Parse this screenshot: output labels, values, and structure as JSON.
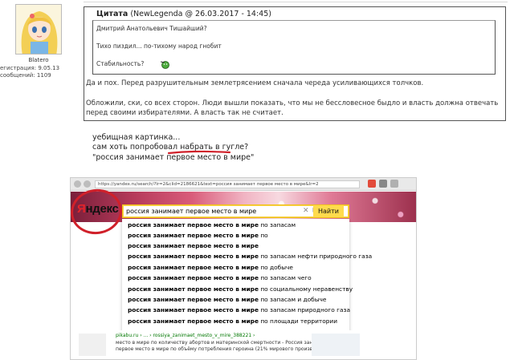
{
  "user": {
    "name": "Blatero",
    "registration_label": "егистрация:",
    "registration_date": "9.05.13",
    "messages_label": "сообщений:",
    "messages_count": "1109"
  },
  "quote": {
    "title": "Цитата",
    "source": "(NewLegenda @ 26.03.2017 - 14:45)",
    "inner_lines": [
      "Дмитрий Анатольевич Тишайший?",
      "Тихо пиздил... по-тихому народ гнобит",
      "Стабильность?"
    ],
    "text_lines": [
      "Да и пох. Перед разрушительным землетрясением сначала череда усиливающихся толчков.",
      "Обложили, ски, со всех сторон. Люди вышли показать, что мы не бессловесное быдло и власть должна отвечать",
      "перед своими избирателями. А власть так не считает."
    ]
  },
  "post": {
    "lines": [
      "уебищная картинка...",
      "сам хоть попробовал набрать в гугле?",
      "\"россия занимает первое место в мире\""
    ]
  },
  "screenshot": {
    "url": "https://yandex.ru/search/?lr=2&clid=2186621&text=россия занимает первое место в мире&lr=2",
    "logo": {
      "first": "Я",
      "rest": "ндекс"
    },
    "query": "россия занимает первое место в мире",
    "find_button": "Найти",
    "suggestions": [
      {
        "bold": "россия занимает первое место в мире",
        "rest": " по запасам"
      },
      {
        "bold": "россия занимает первое место в мире",
        "rest": " по"
      },
      {
        "bold": "россия занимает первое место в мире",
        "rest": ""
      },
      {
        "bold": "россия занимает первое место в мире",
        "rest": " по запасам нефти природного газа"
      },
      {
        "bold": "россия занимает первое место в мире",
        "rest": " по добыче"
      },
      {
        "bold": "россия занимает первое место в мире",
        "rest": " по запасам чего"
      },
      {
        "bold": "россия занимает первое место в мире",
        "rest": " по социальному неравенству"
      },
      {
        "bold": "россия занимает первое место в мире",
        "rest": " по запасам и добыче"
      },
      {
        "bold": "россия занимает первое место в мире",
        "rest": " по запасам природного газа"
      },
      {
        "bold": "россия занимает первое место в мире",
        "rest": " по площади территории"
      }
    ],
    "result": {
      "url": "pikabu.ru › ... › rossiya_zanimaet_mesto_v_mire_388221 ›",
      "line1": "место в мире по количеству абортов и материнской смертности - Россия занимает",
      "line2": "первое место в мире по объёму потребления героина (21% мирового производства)..."
    }
  },
  "colors": {
    "accent_red": "#d0202a",
    "yandex_yellow": "#ffdb4d"
  }
}
